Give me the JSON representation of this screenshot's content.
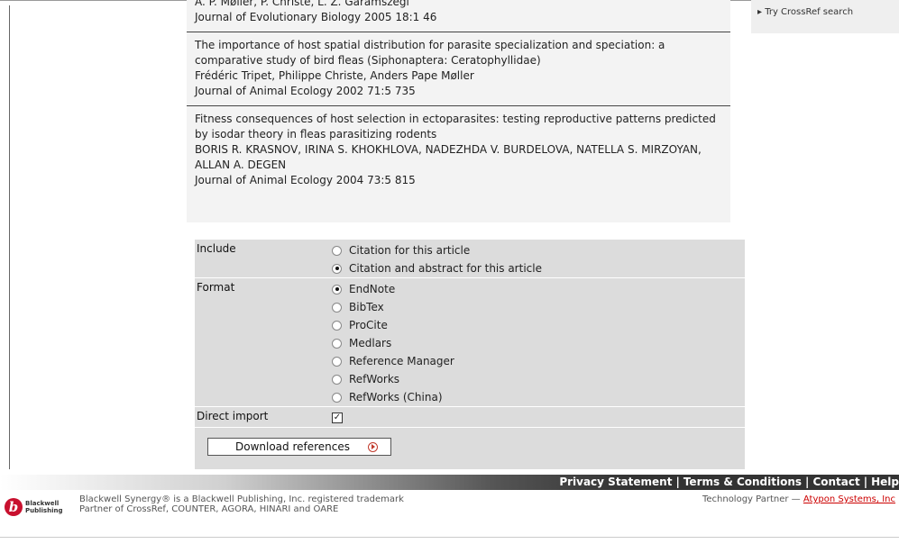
{
  "references": [
    {
      "title": "",
      "authors": "A. P. Møller, P. Christe, L. Z. Garamszegi",
      "journal": "Journal of Evolutionary Biology 2005 18:1 46"
    },
    {
      "title": "The importance of host spatial distribution for parasite specialization and speciation: a comparative study of bird fleas (Siphonaptera: Ceratophyllidae)",
      "authors": "Frédéric Tripet, Philippe Christe, Anders Pape Møller",
      "journal": "Journal of Animal Ecology 2002 71:5 735"
    },
    {
      "title": "Fitness consequences of host selection in ectoparasites: testing reproductive patterns predicted by isodar theory in fleas parasitizing rodents",
      "authors": "BORIS R. KRASNOV, IRINA S. KHOKHLOVA, NADEZHDA V. BURDELOVA, NATELLA S. MIRZOYAN, ALLAN A. DEGEN",
      "journal": "Journal of Animal Ecology 2004 73:5 815"
    }
  ],
  "sidebar": {
    "crossref_link": "▸ Try CrossRef search"
  },
  "form": {
    "include_label": "Include",
    "include_options": [
      "Citation for this article",
      "Citation and abstract for this article"
    ],
    "include_selected": 1,
    "format_label": "Format",
    "format_options": [
      "EndNote",
      "BibTex",
      "ProCite",
      "Medlars",
      "Reference Manager",
      "RefWorks",
      "RefWorks (China)"
    ],
    "format_selected": 0,
    "direct_import_label": "Direct import",
    "direct_import_checked": true,
    "download_label": "Download references"
  },
  "footer": {
    "links": [
      "Privacy Statement",
      "Terms & Conditions",
      "Contact",
      "Help"
    ],
    "logo_text_1": "Blackwell",
    "logo_text_2": "Publishing",
    "line1": "Blackwell Synergy® is a Blackwell Publishing, Inc. registered trademark",
    "line2": "Partner of CrossRef, COUNTER, AGORA, HINARI and OARE",
    "tech_label": "Technology Partner — ",
    "tech_link": "Atypon Systems, Inc"
  },
  "colors": {
    "accent": "#c8102e",
    "panel": "#f3f3f3",
    "form_bg": "#dcdcdc"
  }
}
